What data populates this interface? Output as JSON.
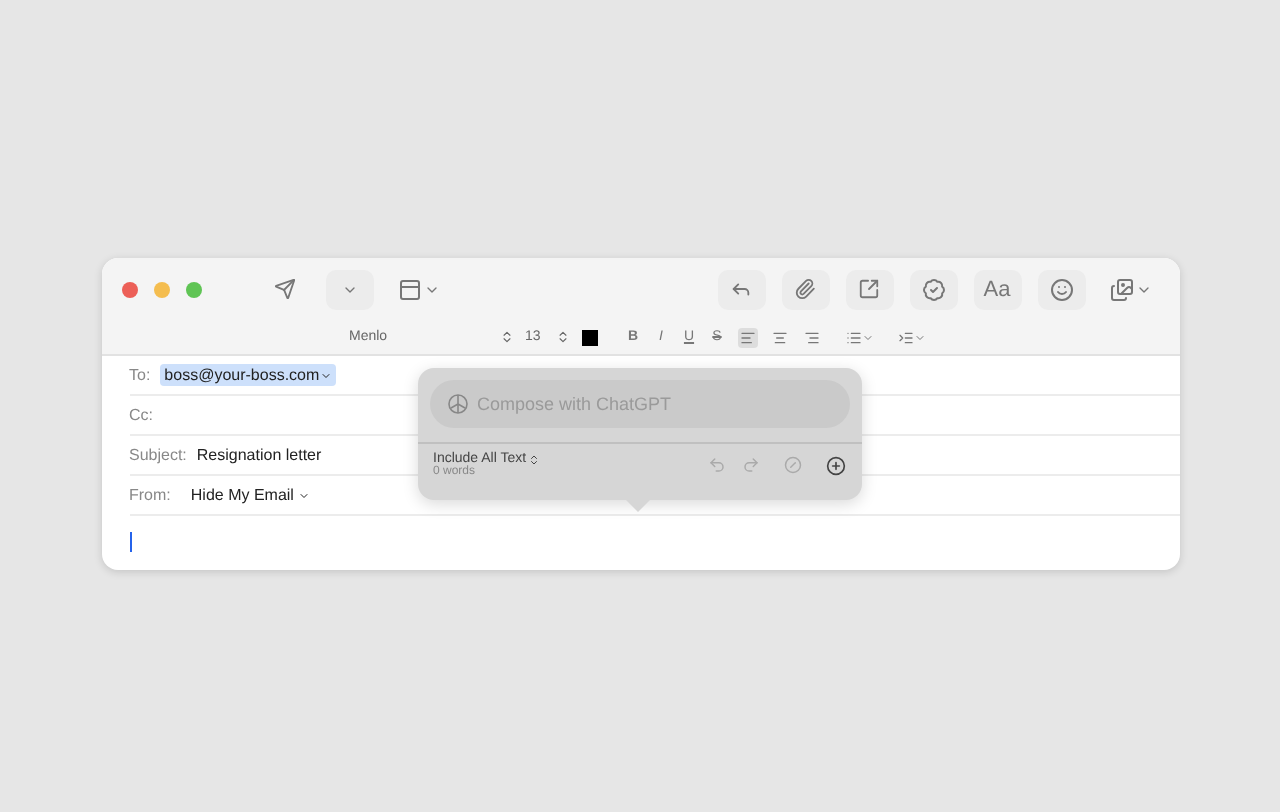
{
  "toolbar": {
    "font_button": "Aa"
  },
  "format_bar": {
    "font": "Menlo",
    "size": "13",
    "styles": [
      "B",
      "I",
      "U",
      "S"
    ],
    "alignments": [
      {
        "kind": "left",
        "selected": true
      },
      {
        "kind": "center",
        "selected": false
      },
      {
        "kind": "right",
        "selected": false
      }
    ]
  },
  "fields": [
    {
      "label": "To:",
      "value": "boss@your-boss.com",
      "kind": "token"
    },
    {
      "label": "Cc:",
      "kind": "text"
    },
    {
      "label": "Subject:",
      "value": "Resignation letter",
      "kind": "text"
    },
    {
      "label": "From:",
      "value": "Hide My Email",
      "kind": "select"
    }
  ],
  "popup": {
    "placeholder": "Compose with ChatGPT",
    "scope": "Include All Text",
    "count": "0 words"
  }
}
